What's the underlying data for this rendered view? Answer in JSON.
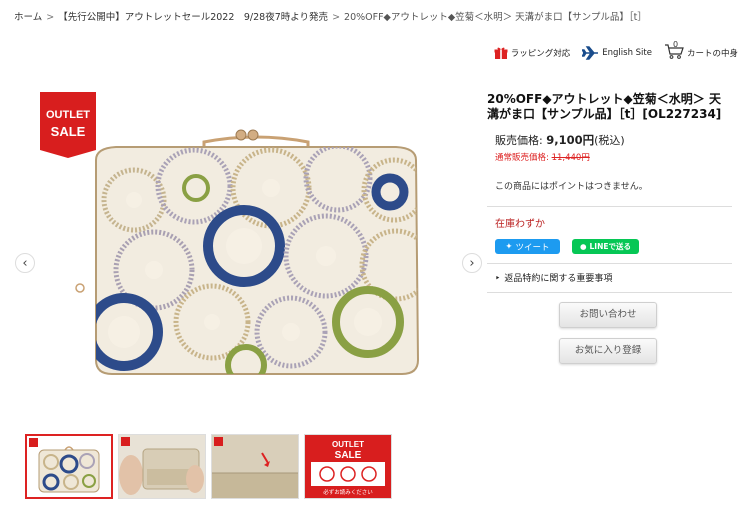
{
  "breadcrumb": {
    "items": [
      "ホーム",
      "【先行公開中】アウトレットセール2022　9/28夜7時より発売"
    ],
    "current": "20%OFF◆アウトレット◆笠菊＜水明＞ 天溝がま口【サンプル品】［t］"
  },
  "header": {
    "wrapping": "ラッピング対応",
    "english": "English Site",
    "cart_label": "カートの中身",
    "cart_count": "0"
  },
  "badge": {
    "line1": "OUTLET",
    "line2": "SALE"
  },
  "product": {
    "title": "20%OFF◆アウトレット◆笠菊＜水明＞ 天溝がま口【サンプル品】［t］[OL227234]",
    "price_label": "販売価格:",
    "price": "9,100円",
    "tax_note": "(税込)",
    "regular_label": "通常販売価格:",
    "regular_price": "11,440円",
    "points_note": "この商品にはポイントはつきません。",
    "stock": "在庫わずか",
    "tweet": "ツイート",
    "line": "LINEで送る",
    "returns": "返品特約に関する重要事項",
    "inquiry_button": "お問い合わせ",
    "favorite_button": "お気に入り登録"
  },
  "thumb4": {
    "line1": "OUTLET",
    "line2": "SALE",
    "footer": "必ずお読みください"
  },
  "colors": {
    "accent_red": "#d22222",
    "tweet_blue": "#1d9bf0",
    "line_green": "#06c755"
  }
}
